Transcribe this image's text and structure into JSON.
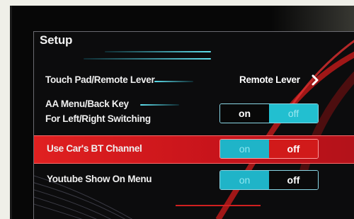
{
  "screen": {
    "title": "Setup"
  },
  "settings": [
    {
      "label": "Touch Pad/Remote Lever",
      "value": "Remote Lever"
    },
    {
      "label_line1": "AA Menu/Back Key",
      "label_line2": "For Left/Right Switching",
      "on": "on",
      "off": "off",
      "selected": "on"
    },
    {
      "label": "Use Car's BT Channel",
      "on": "on",
      "off": "off",
      "selected": "off"
    },
    {
      "label": "Youtube Show On Menu",
      "on": "on",
      "off": "off",
      "selected": "on"
    }
  ],
  "icons": {
    "chevron": "chevron-right-icon"
  },
  "colors": {
    "accent_cyan": "#1fb4c8",
    "highlight_red": "#d11a1a",
    "background": "#0c0c0d"
  }
}
